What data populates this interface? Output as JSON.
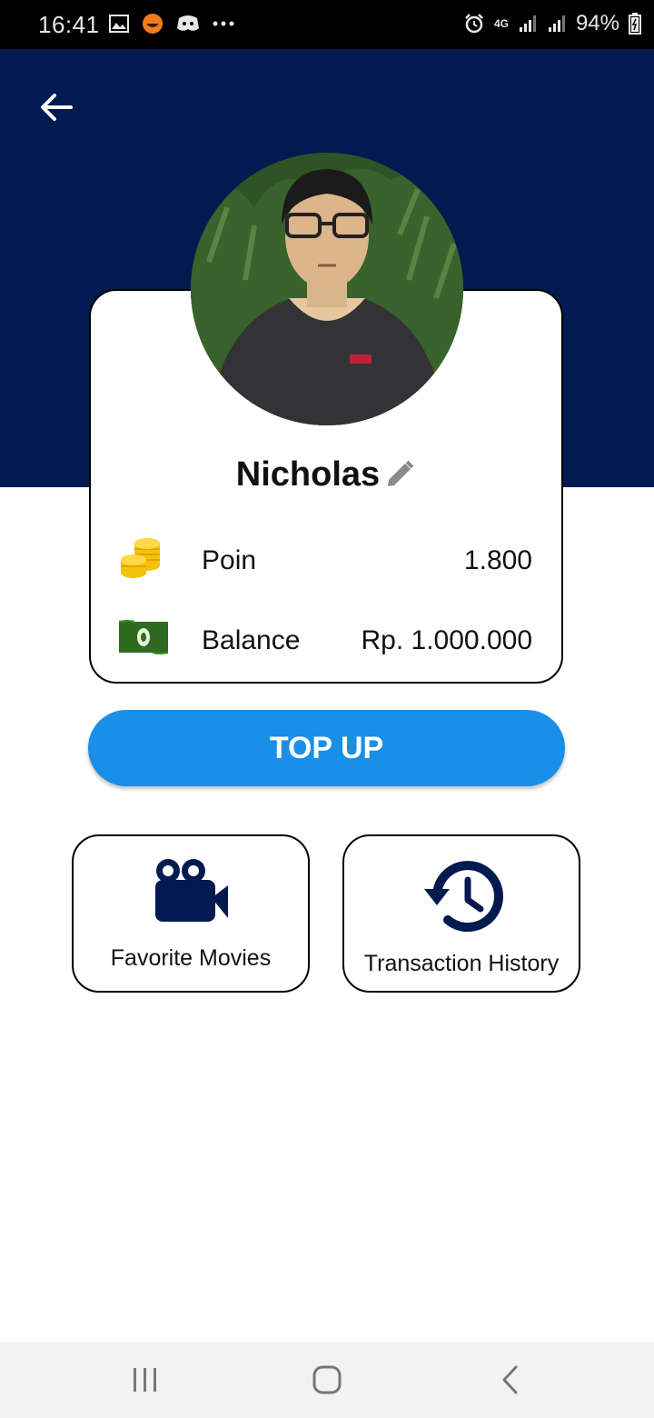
{
  "status_bar": {
    "time": "16:41",
    "battery": "94%",
    "network": "4G",
    "icons_left": [
      "image-icon",
      "app-notification-icon",
      "discord-icon",
      "more-dots-icon"
    ],
    "icons_right": [
      "alarm-icon",
      "4g-icon",
      "signal-icon",
      "signal-icon",
      "battery-icon"
    ]
  },
  "header": {
    "background": "#021A4F",
    "back_icon": "arrow-back-icon"
  },
  "profile": {
    "name": "Nicholas",
    "edit_icon": "pencil-icon",
    "stats": [
      {
        "icon": "coins-icon",
        "label": "Poin",
        "value": "1.800"
      },
      {
        "icon": "banknote-icon",
        "label": "Balance",
        "value": "Rp. 1.000.000"
      }
    ]
  },
  "actions": {
    "top_up_label": "TOP UP",
    "top_up_color": "#1A8FE8",
    "tiles": [
      {
        "icon": "movie-camera-icon",
        "label": "Favorite Movies"
      },
      {
        "icon": "history-icon",
        "label": "Transaction History"
      }
    ]
  },
  "nav_bar": {
    "buttons": [
      "recent-apps-icon",
      "home-icon",
      "back-icon"
    ]
  }
}
